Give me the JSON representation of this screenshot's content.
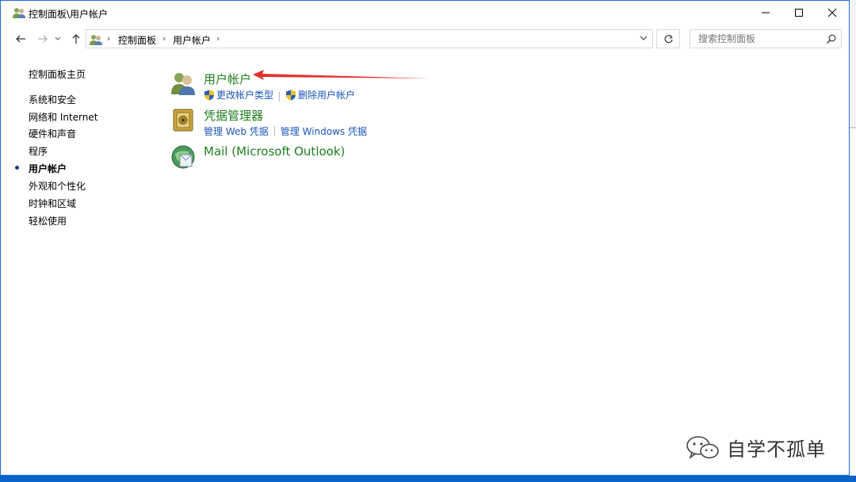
{
  "window": {
    "title": "控制面板\\用户帐户"
  },
  "address": {
    "crumbs": [
      "控制面板",
      "用户帐户"
    ]
  },
  "search": {
    "placeholder": "搜索控制面板"
  },
  "sidebar": {
    "home": "控制面板主页",
    "items": [
      {
        "label": "系统和安全"
      },
      {
        "label": "网络和 Internet"
      },
      {
        "label": "硬件和声音"
      },
      {
        "label": "程序"
      },
      {
        "label": "用户帐户",
        "selected": true
      },
      {
        "label": "外观和个性化"
      },
      {
        "label": "时钟和区域"
      },
      {
        "label": "轻松使用"
      }
    ]
  },
  "categories": [
    {
      "title": "用户帐户",
      "icon": "users-icon",
      "links": [
        "更改帐户类型",
        "删除用户帐户"
      ]
    },
    {
      "title": "凭据管理器",
      "icon": "credential-vault-icon",
      "links": [
        "管理 Web 凭据",
        "管理 Windows 凭据"
      ]
    },
    {
      "title": "Mail (Microsoft Outlook)",
      "icon": "mail-icon",
      "links": []
    }
  ],
  "watermark": {
    "text": "自学不孤单"
  },
  "colors": {
    "category_title": "#1e7d1e",
    "link": "#1a55b8",
    "annotation_arrow": "#e53030",
    "taskbar": "#0a64c8"
  }
}
